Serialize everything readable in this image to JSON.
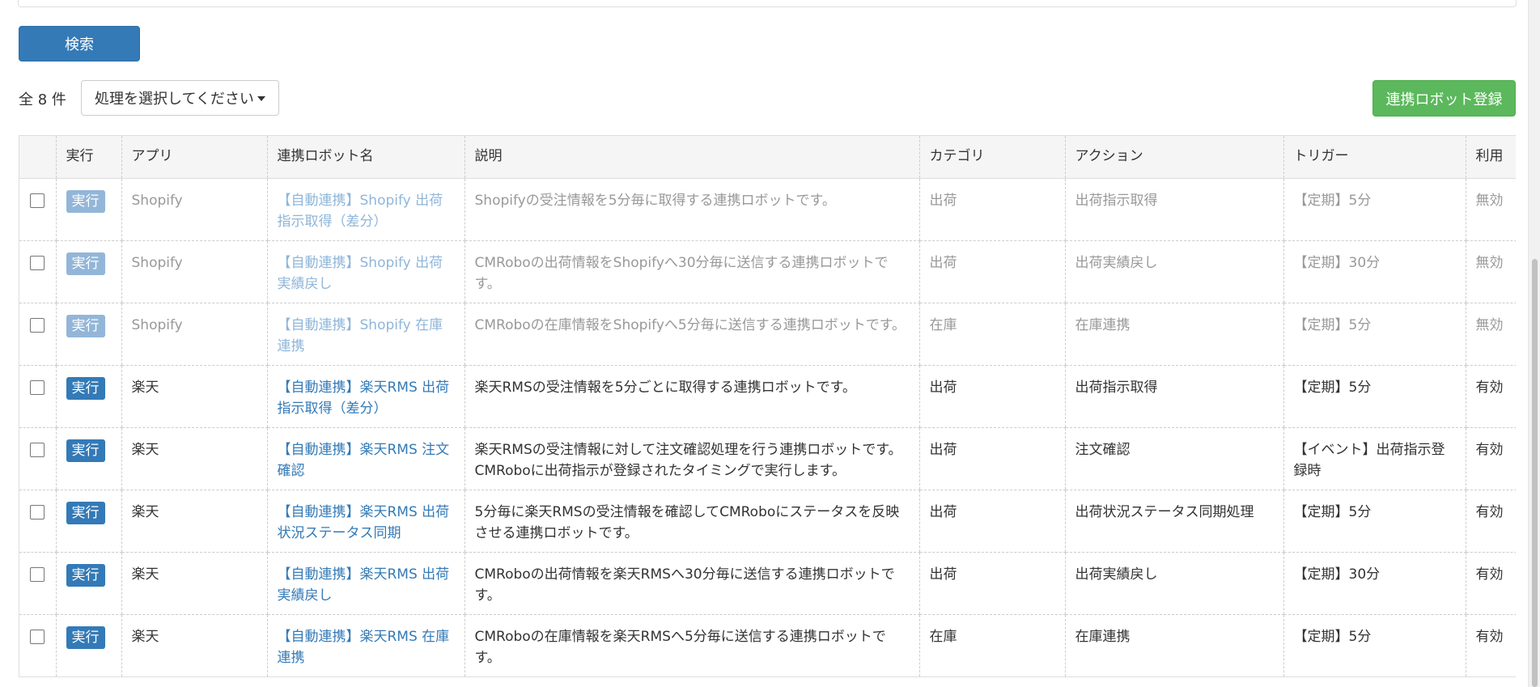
{
  "search_button": "検索",
  "total_count": "全 8 件",
  "action_select": {
    "value": "処理を選択してください"
  },
  "register_button": "連携ロボット登録",
  "columns": [
    "",
    "実行",
    "アプリ",
    "連携ロボット名",
    "説明",
    "カテゴリ",
    "アクション",
    "トリガー",
    "利用"
  ],
  "rows": [
    {
      "run": "実行",
      "app": "Shopify",
      "name": "【自動連携】Shopify 出荷指示取得（差分）",
      "desc": "Shopifyの受注情報を5分毎に取得する連携ロボットです。",
      "category": "出荷",
      "action": "出荷指示取得",
      "trigger": "【定期】5分",
      "status": "無効"
    },
    {
      "run": "実行",
      "app": "Shopify",
      "name": "【自動連携】Shopify 出荷実績戻し",
      "desc": "CMRoboの出荷情報をShopifyへ30分毎に送信する連携ロボットです。",
      "category": "出荷",
      "action": "出荷実績戻し",
      "trigger": "【定期】30分",
      "status": "無効"
    },
    {
      "run": "実行",
      "app": "Shopify",
      "name": "【自動連携】Shopify 在庫連携",
      "desc": "CMRoboの在庫情報をShopifyへ5分毎に送信する連携ロボットです。",
      "category": "在庫",
      "action": "在庫連携",
      "trigger": "【定期】5分",
      "status": "無効"
    },
    {
      "run": "実行",
      "app": "楽天",
      "name": "【自動連携】楽天RMS 出荷指示取得（差分）",
      "desc": "楽天RMSの受注情報を5分ごとに取得する連携ロボットです。",
      "category": "出荷",
      "action": "出荷指示取得",
      "trigger": "【定期】5分",
      "status": "有効"
    },
    {
      "run": "実行",
      "app": "楽天",
      "name": "【自動連携】楽天RMS 注文確認",
      "desc": "楽天RMSの受注情報に対して注文確認処理を行う連携ロボットです。 CMRoboに出荷指示が登録されたタイミングで実行します。",
      "category": "出荷",
      "action": "注文確認",
      "trigger": "【イベント】出荷指示登録時",
      "status": "有効"
    },
    {
      "run": "実行",
      "app": "楽天",
      "name": "【自動連携】楽天RMS 出荷状況ステータス同期",
      "desc": "5分毎に楽天RMSの受注情報を確認してCMRoboにステータスを反映させる連携ロボットです。",
      "category": "出荷",
      "action": "出荷状況ステータス同期処理",
      "trigger": "【定期】5分",
      "status": "有効"
    },
    {
      "run": "実行",
      "app": "楽天",
      "name": "【自動連携】楽天RMS 出荷実績戻し",
      "desc": "CMRoboの出荷情報を楽天RMSへ30分毎に送信する連携ロボットです。",
      "category": "出荷",
      "action": "出荷実績戻し",
      "trigger": "【定期】30分",
      "status": "有効"
    },
    {
      "run": "実行",
      "app": "楽天",
      "name": "【自動連携】楽天RMS 在庫連携",
      "desc": "CMRoboの在庫情報を楽天RMSへ5分毎に送信する連携ロボットです。",
      "category": "在庫",
      "action": "在庫連携",
      "trigger": "【定期】5分",
      "status": "有効"
    }
  ]
}
